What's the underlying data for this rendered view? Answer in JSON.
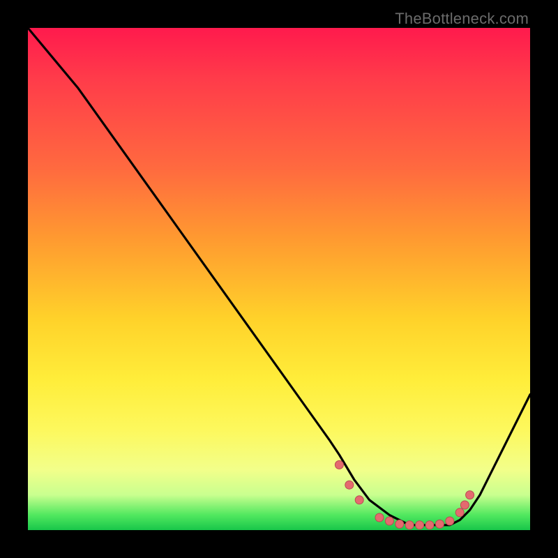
{
  "watermark": "TheBottleneck.com",
  "colors": {
    "curve_stroke": "#000000",
    "dots_fill": "#e46a6f",
    "dots_stroke": "#b94b52"
  },
  "chart_data": {
    "type": "line",
    "title": "",
    "xlabel": "",
    "ylabel": "",
    "xlim": [
      0,
      100
    ],
    "ylim": [
      0,
      100
    ],
    "series": [
      {
        "name": "curve",
        "x": [
          0,
          5,
          10,
          15,
          20,
          25,
          30,
          35,
          40,
          45,
          50,
          55,
          60,
          62,
          65,
          68,
          72,
          76,
          80,
          84,
          86,
          88,
          90,
          92,
          95,
          100
        ],
        "y": [
          100,
          94,
          88,
          81,
          74,
          67,
          60,
          53,
          46,
          39,
          32,
          25,
          18,
          15,
          10,
          6,
          3,
          1,
          1,
          1,
          2,
          4,
          7,
          11,
          17,
          27
        ]
      }
    ],
    "scatter_overlay": {
      "name": "dots",
      "points": [
        {
          "x": 62,
          "y": 13
        },
        {
          "x": 64,
          "y": 9
        },
        {
          "x": 66,
          "y": 6
        },
        {
          "x": 70,
          "y": 2.5
        },
        {
          "x": 72,
          "y": 1.8
        },
        {
          "x": 74,
          "y": 1.2
        },
        {
          "x": 76,
          "y": 1.0
        },
        {
          "x": 78,
          "y": 1.0
        },
        {
          "x": 80,
          "y": 1.0
        },
        {
          "x": 82,
          "y": 1.2
        },
        {
          "x": 84,
          "y": 1.8
        },
        {
          "x": 86,
          "y": 3.5
        },
        {
          "x": 87,
          "y": 5
        },
        {
          "x": 88,
          "y": 7
        }
      ]
    }
  }
}
